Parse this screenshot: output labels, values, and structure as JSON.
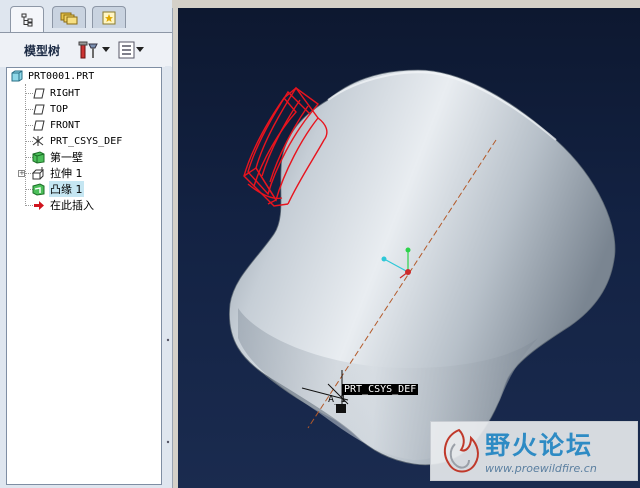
{
  "model_tree": {
    "title": "模型树",
    "tabs": [
      {
        "icon": "tree-icon",
        "active": true
      },
      {
        "icon": "folders-icon",
        "active": false
      },
      {
        "icon": "favorites-icon",
        "active": false
      }
    ],
    "toolbar": {
      "settings_icon": "tools-icon",
      "show_icon": "list-icon"
    },
    "items": [
      {
        "label": "PRT0001.PRT",
        "icon": "part-icon"
      },
      {
        "label": "RIGHT",
        "icon": "datum-plane-icon"
      },
      {
        "label": "TOP",
        "icon": "datum-plane-icon"
      },
      {
        "label": "FRONT",
        "icon": "datum-plane-icon"
      },
      {
        "label": "PRT_CSYS_DEF",
        "icon": "csys-icon"
      },
      {
        "label": "第一壁",
        "icon": "first-wall-icon"
      },
      {
        "label": "拉伸 1",
        "icon": "extrude-icon"
      },
      {
        "label": "凸缘 1",
        "icon": "flange-icon",
        "selected": true
      },
      {
        "label": "在此插入",
        "icon": "insert-here-icon"
      }
    ]
  },
  "viewport": {
    "csys_label": "PRT_CSYS_DEF",
    "axis_label": "A_1",
    "background_top": "#0d1830",
    "background_bottom": "#1a2b4f",
    "highlight_color": "#e8141e"
  },
  "watermark": {
    "title": "野火论坛",
    "url": "www.proewildfire.cn"
  }
}
